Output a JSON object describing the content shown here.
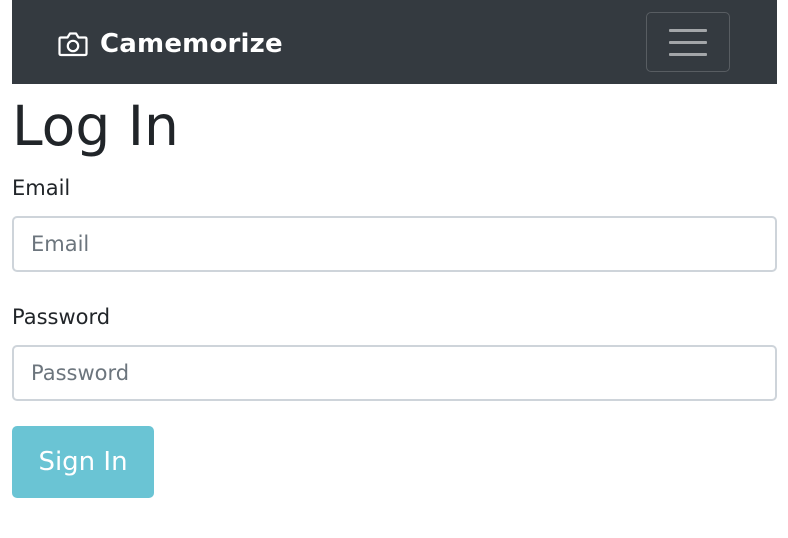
{
  "navbar": {
    "brand_icon": "camera-icon",
    "brand_name": "Camemorize",
    "toggler_icon": "hamburger-menu-icon",
    "background_color": "#343a40"
  },
  "page": {
    "title": "Log In"
  },
  "form": {
    "email": {
      "label": "Email",
      "placeholder": "Email",
      "value": ""
    },
    "password": {
      "label": "Password",
      "placeholder": "Password",
      "value": ""
    },
    "submit_label": "Sign In",
    "submit_color": "#6ac4d4"
  }
}
